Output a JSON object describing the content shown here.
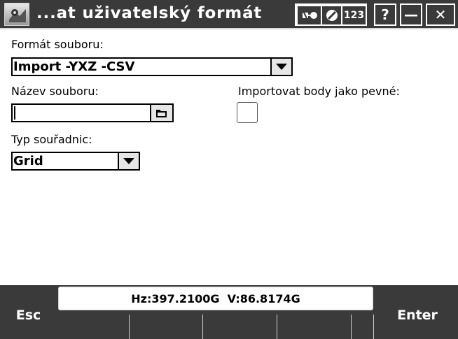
{
  "window": {
    "title": "...at uživatelský formát",
    "status_icons": [
      "satellite-icon",
      "no-entry-icon"
    ],
    "status_text": "123",
    "help_label": "?",
    "minimize_label": "—",
    "close_label": "✕"
  },
  "form": {
    "file_format": {
      "label": "Formát souboru:",
      "value": "Import -YXZ -CSV"
    },
    "file_name": {
      "label": "Název souboru:",
      "value": ""
    },
    "import_fixed": {
      "label": "Importovat body jako pevné:",
      "checked": false
    },
    "coord_type": {
      "label": "Typ souřadnic:",
      "value": "Grid"
    }
  },
  "softkeys": {
    "left": "Esc",
    "right": "Enter",
    "measurement": "Hz:397.2100G  V:86.8174G"
  }
}
